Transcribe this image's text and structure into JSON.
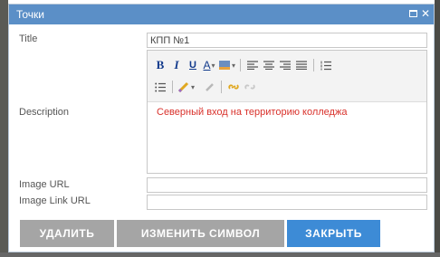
{
  "dialog": {
    "title": "Точки"
  },
  "labels": {
    "title": "Title",
    "description": "Description",
    "image_url": "Image URL",
    "image_link_url": "Image Link URL"
  },
  "fields": {
    "title_value": "КПП №1",
    "image_url_value": "",
    "image_link_url_value": ""
  },
  "editor": {
    "content": "Северный вход на территорию колледжа",
    "content_color": "#d9312b",
    "toolbar": {
      "bold": "B",
      "italic": "I",
      "underline": "U",
      "font_color": "A",
      "icons": [
        "bold-icon",
        "italic-icon",
        "underline-icon",
        "font-color-icon",
        "highlight-icon",
        "align-left-icon",
        "align-center-icon",
        "align-right-icon",
        "align-justify-icon",
        "ordered-list-icon",
        "unordered-list-icon",
        "remove-format-icon",
        "insert-link-icon",
        "unlink-icon"
      ]
    }
  },
  "buttons": {
    "delete": "УДАЛИТЬ",
    "change_symbol": "ИЗМЕНИТЬ СИМВОЛ",
    "close": "ЗАКРЫТЬ"
  },
  "colors": {
    "titlebar": "#5b8fc7",
    "primary_button": "#3d8bd6",
    "secondary_button": "#a5a5a5"
  }
}
